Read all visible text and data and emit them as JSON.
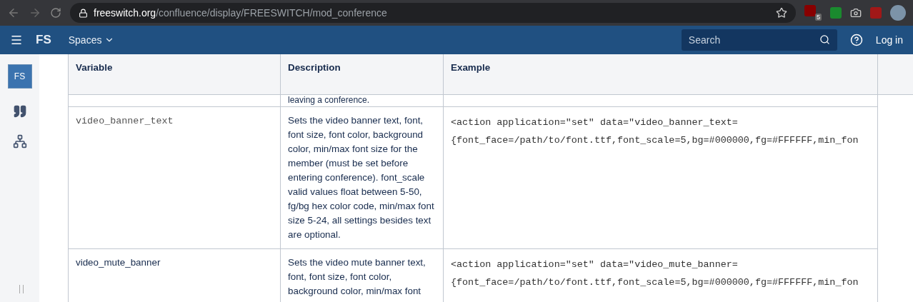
{
  "browser": {
    "url_host": "freeswitch.org",
    "url_path": "/confluence/display/FREESWITCH/mod_conference",
    "extension_badge": "5"
  },
  "nav": {
    "logo": "FS",
    "spaces": "Spaces",
    "search": {
      "placeholder": "Search"
    },
    "login": "Log in"
  },
  "sidebar": {
    "logo": "FS"
  },
  "table": {
    "columns": [
      "Variable",
      "Description",
      "Example"
    ],
    "partial_row": {
      "description": "leaving a conference."
    },
    "rows": [
      {
        "variable": "video_banner_text",
        "monospace": true,
        "description": "Sets the video banner text, font, font size, font color, background color, min/max font size for the member (must be set before entering conference). font_scale valid values float between 5-50, fg/bg hex color code, min/max font size 5-24, all settings besides text are optional.",
        "example": [
          "<action application=\"set\" data=\"video_banner_text=",
          "{font_face=/path/to/font.ttf,font_scale=5,bg=#000000,fg=#FFFFFF,min_fon"
        ]
      },
      {
        "variable": "video_mute_banner",
        "monospace": false,
        "description": "Sets the video mute banner text, font, font size, font color, background color, min/max font",
        "example": [
          "<action application=\"set\" data=\"video_mute_banner=",
          "{font_face=/path/to/font.ttf,font_scale=5,bg=#000000,fg=#FFFFFF,min_fon"
        ]
      }
    ]
  }
}
